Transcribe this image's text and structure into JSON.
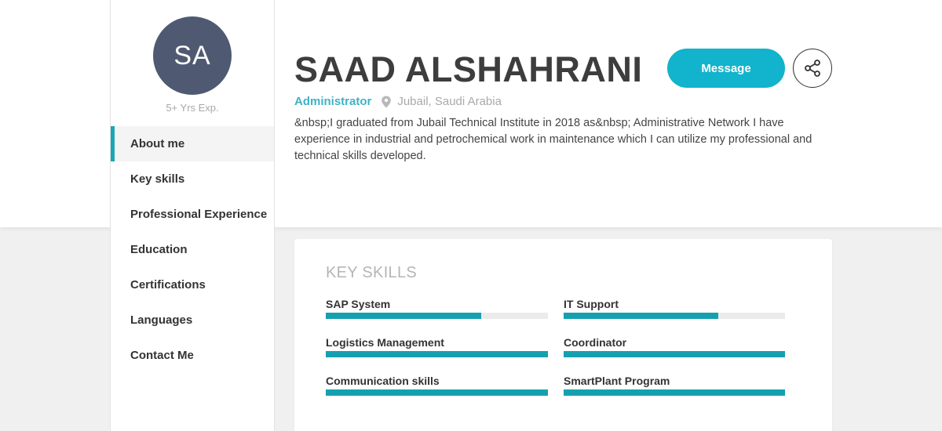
{
  "profile": {
    "initials": "SA",
    "experience": "5+ Yrs Exp.",
    "name": "SAAD ALSHAHRANI",
    "role": "Administrator",
    "location": "Jubail, Saudi Arabia",
    "bio": "&nbsp;I graduated from Jubail Technical Institute in 2018 as&nbsp; Administrative Network I have experience in industrial and petrochemical work in maintenance which I can utilize my professional and technical skills developed."
  },
  "actions": {
    "message_label": "Message",
    "share_icon": "share-icon"
  },
  "nav": {
    "items": [
      {
        "label": "About me",
        "active": true
      },
      {
        "label": "Key skills",
        "active": false
      },
      {
        "label": "Professional Experience",
        "active": false
      },
      {
        "label": "Education",
        "active": false
      },
      {
        "label": "Certifications",
        "active": false
      },
      {
        "label": "Languages",
        "active": false
      },
      {
        "label": "Contact Me",
        "active": false
      }
    ]
  },
  "skills_section": {
    "title": "KEY SKILLS",
    "skills": [
      {
        "label": "SAP System",
        "level": 0.7
      },
      {
        "label": "IT Support",
        "level": 0.7
      },
      {
        "label": "Logistics Management",
        "level": 1.0
      },
      {
        "label": "Coordinator",
        "level": 1.0
      },
      {
        "label": "Communication skills",
        "level": 1.0
      },
      {
        "label": "SmartPlant Program",
        "level": 1.0
      }
    ]
  },
  "colors": {
    "accent": "#12b3cc",
    "bar": "#15a0b0",
    "avatar": "#4f5a72"
  }
}
